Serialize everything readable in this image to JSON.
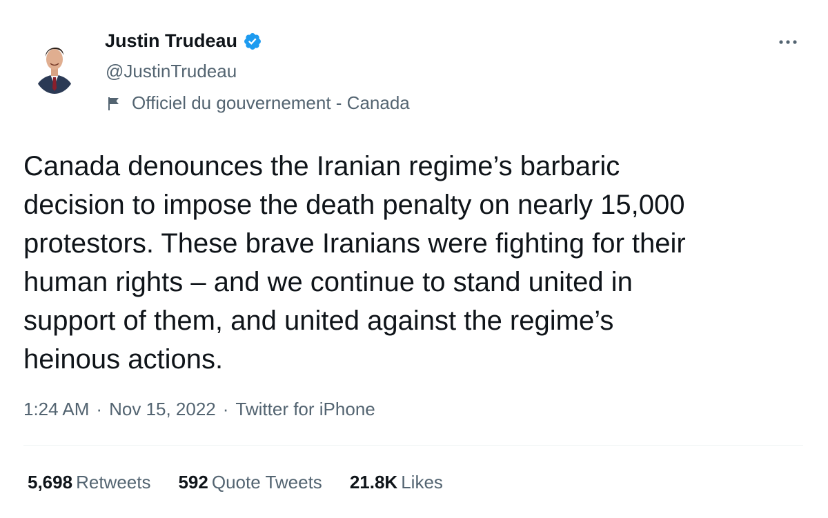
{
  "author": {
    "name": "Justin Trudeau",
    "handle": "@JustinTrudeau",
    "label": "Officiel du gouvernement - Canada",
    "verified_color": "#1d9bf0"
  },
  "tweet": {
    "text": "Canada denounces the Iranian regime’s barbaric\ndecision to impose the death penalty on nearly 15,000\nprotestors. These brave Iranians were fighting for their\nhuman rights – and we continue to stand united in\nsupport of them, and united against the regime’s\nheinous actions.",
    "time": "1:24 AM",
    "separator": "·",
    "date": "Nov 15, 2022",
    "source": "Twitter for iPhone"
  },
  "stats": {
    "retweets_count": "5,698",
    "retweets_label": "Retweets",
    "quotes_count": "592",
    "quotes_label": "Quote Tweets",
    "likes_count": "21.8K",
    "likes_label": "Likes"
  },
  "icons": {
    "avatar": "avatar-photo",
    "verified": "verified-badge-icon",
    "flag": "flag-icon",
    "more": "more-options-icon"
  }
}
